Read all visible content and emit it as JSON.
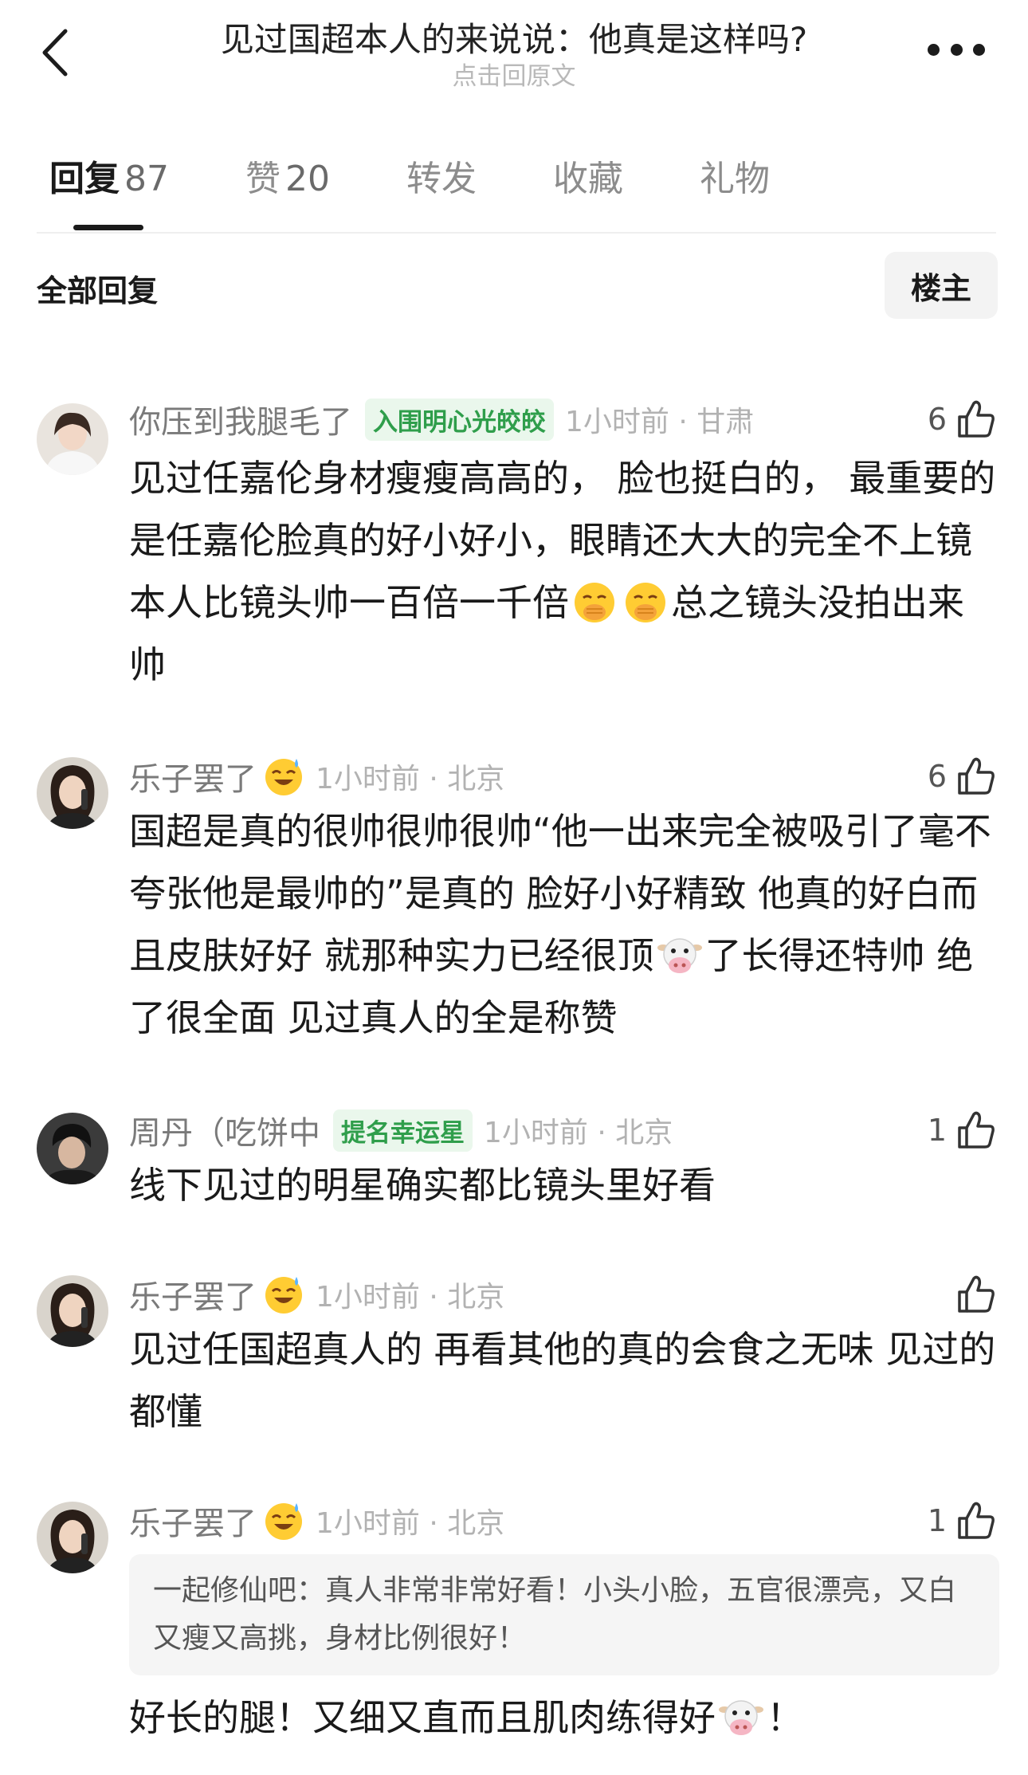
{
  "header": {
    "title": "见过国超本人的来说说：他真是这样吗?",
    "subtitle": "点击回原文"
  },
  "tabs": [
    {
      "label": "回复",
      "count": "87"
    },
    {
      "label": "赞",
      "count": "20"
    },
    {
      "label": "转发"
    },
    {
      "label": "收藏"
    },
    {
      "label": "礼物"
    }
  ],
  "sort": {
    "label": "全部回复",
    "owner_button": "楼主"
  },
  "comments": [
    {
      "user": "你压到我腿毛了",
      "badge": "入围明心光皎皎",
      "time": "1小时前 · 甘肃",
      "likes": "6",
      "text1": "见过任嘉伦身材瘦瘦高高的， 脸也挺白的， 最重要的是任嘉伦脸真的好小好小，眼睛还大大的完全不上镜 本人比镜头帅一百倍一千倍",
      "text2": "总之镜头没拍出来帅",
      "emoji": "hand-over-mouth"
    },
    {
      "user": "乐子罢了",
      "time": "1小时前 · 北京",
      "likes": "6",
      "text1": "国超是真的很帅很帅很帅“他一出来完全被吸引了毫不夸张他是最帅的”是真的 脸好小好精致 他真的好白而且皮肤好好 就那种实力已经很顶",
      "text2": "了长得还特帅 绝了很全面 见过真人的全是称赞",
      "emoji": "cow-face"
    },
    {
      "user": "周丹（吃饼中",
      "badge": "提名幸运星",
      "time": "1小时前 · 北京",
      "likes": "1",
      "text1": "线下见过的明星确实都比镜头里好看"
    },
    {
      "user": "乐子罢了",
      "time": "1小时前 · 北京",
      "likes": "",
      "text1": "见过任国超真人的 再看其他的真的会食之无味 见过的都懂"
    },
    {
      "user": "乐子罢了",
      "time": "1小时前 · 北京",
      "likes": "1",
      "quote": "一起修仙吧：真人非常非常好看！小头小脸，五官很漂亮，又白又瘦又高挑，身材比例很好！",
      "text1": "好长的腿！又细又直而且肌肉练得好",
      "text2": "！",
      "emoji": "cow-face"
    }
  ],
  "icons": {
    "back": "chevron-left-icon",
    "more": "more-dots-icon",
    "like": "thumb-up-icon",
    "user_emoji": "grinning-sweat-emoji"
  },
  "colors": {
    "badge_bg": "#eaf7ec",
    "badge_text": "#2f9e4b",
    "muted": "#b2b2b2"
  }
}
